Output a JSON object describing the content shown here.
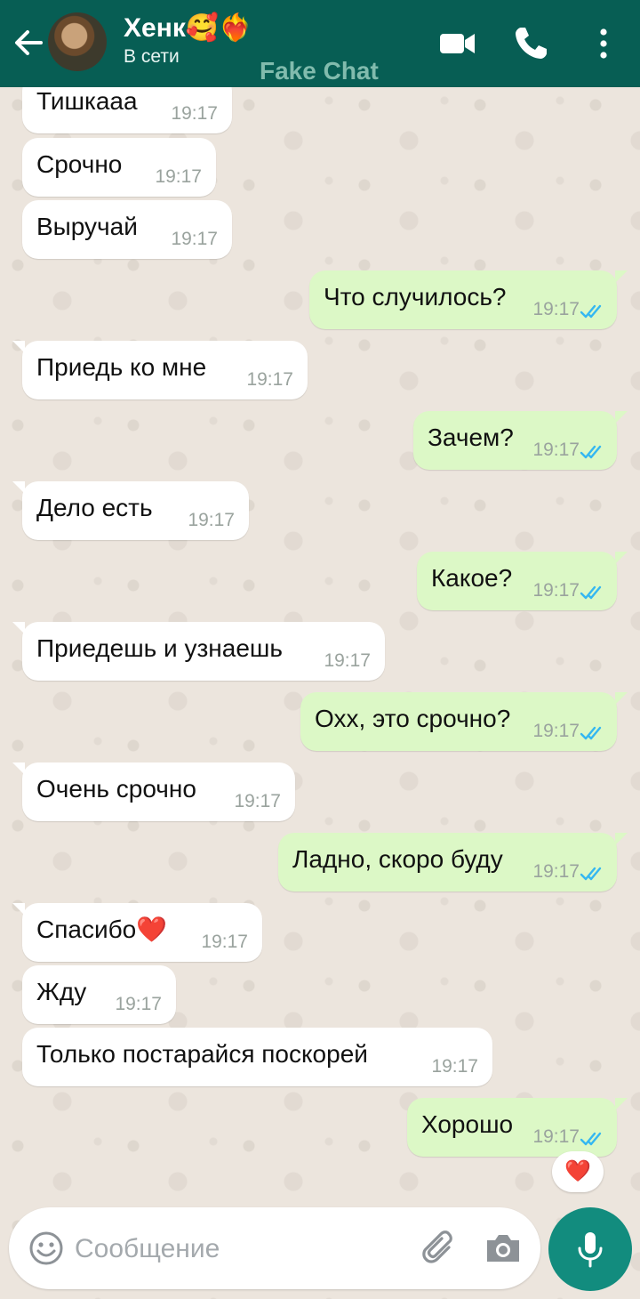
{
  "header": {
    "contact_name": "Хенк🥰❤️‍🔥",
    "status": "В сети",
    "watermark": "Fake Chat"
  },
  "messages": [
    {
      "dir": "in",
      "text": "Тишкааа",
      "time": "19:17"
    },
    {
      "dir": "in",
      "text": "Срочно",
      "time": "19:17"
    },
    {
      "dir": "in",
      "text": "Выручай",
      "time": "19:17"
    },
    {
      "dir": "out",
      "text": "Что случилось?",
      "time": "19:17",
      "read": true
    },
    {
      "dir": "in",
      "text": "Приедь ко мне",
      "time": "19:17"
    },
    {
      "dir": "out",
      "text": "Зачем?",
      "time": "19:17",
      "read": true
    },
    {
      "dir": "in",
      "text": "Дело есть",
      "time": "19:17"
    },
    {
      "dir": "out",
      "text": "Какое?",
      "time": "19:17",
      "read": true
    },
    {
      "dir": "in",
      "text": "Приедешь и узнаешь",
      "time": "19:17"
    },
    {
      "dir": "out",
      "text": "Охх, это срочно?",
      "time": "19:17",
      "read": true
    },
    {
      "dir": "in",
      "text": "Очень срочно",
      "time": "19:17"
    },
    {
      "dir": "out",
      "text": "Ладно, скоро буду",
      "time": "19:17",
      "read": true
    },
    {
      "dir": "in",
      "text": "Спасибо❤️",
      "time": "19:17"
    },
    {
      "dir": "in",
      "text": "Жду",
      "time": "19:17"
    },
    {
      "dir": "in",
      "text": "Только постарайся поскорей",
      "time": "19:17"
    },
    {
      "dir": "out",
      "text": "Хорошо",
      "time": "19:17",
      "read": true
    }
  ],
  "reaction": "❤️",
  "input": {
    "placeholder": "Сообщение",
    "value": ""
  },
  "colors": {
    "header": "#075e54",
    "outgoing_bubble": "#dcf8c6",
    "incoming_bubble": "#ffffff",
    "read_ticks": "#34b7f1",
    "mic_button": "#128c7e"
  },
  "icons": {
    "back": "arrow-left-icon",
    "video": "video-camera-icon",
    "call": "phone-icon",
    "menu": "more-vertical-icon",
    "emoji": "smiley-icon",
    "attach": "paperclip-icon",
    "camera": "camera-icon",
    "mic": "microphone-icon",
    "ticks": "double-check-icon"
  }
}
